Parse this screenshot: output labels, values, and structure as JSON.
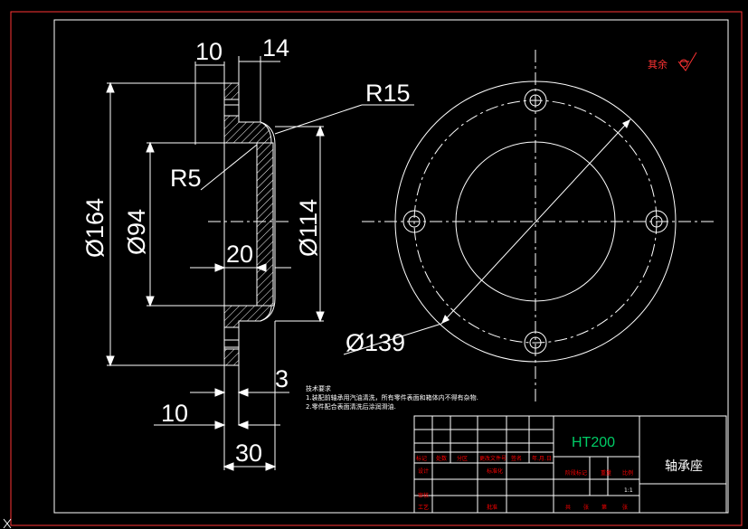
{
  "dimensions": {
    "d10_top": "10",
    "d14_top": "14",
    "r15": "R15",
    "r5": "R5",
    "dia164": "Ø164",
    "dia94": "Ø94",
    "dia114": "Ø114",
    "d20": "20",
    "d3": "3",
    "d10_bottom": "10",
    "d30": "30",
    "dia139": "Ø139"
  },
  "surface_note": "其余",
  "tech_requirements": {
    "title": "技术要求",
    "line1": "1.装配前轴承用汽油清洗，所有零件表面和箱体内不得有杂物.",
    "line2": "2.零件配合表面清洗后涂润滑油."
  },
  "title_block": {
    "material": "HT200",
    "part_name": "轴承座",
    "scale": "1:1",
    "row_labels": [
      "标记",
      "处数",
      "分区",
      "更改文件号",
      "签名",
      "年.月.日"
    ],
    "design": "设计",
    "standardize": "标准化",
    "review": "审核",
    "process": "工艺",
    "approve": "批准",
    "stage_mark": "阶段标记",
    "weight": "重量",
    "ratio": "比例",
    "sheets": "共",
    "sheet_of": "张",
    "sheet_no": "第",
    "sheet_unit": "张"
  },
  "colors": {
    "background": "#000000",
    "lines": "#ffffff",
    "border": "#ff0000",
    "material_text": "#00cc66"
  }
}
